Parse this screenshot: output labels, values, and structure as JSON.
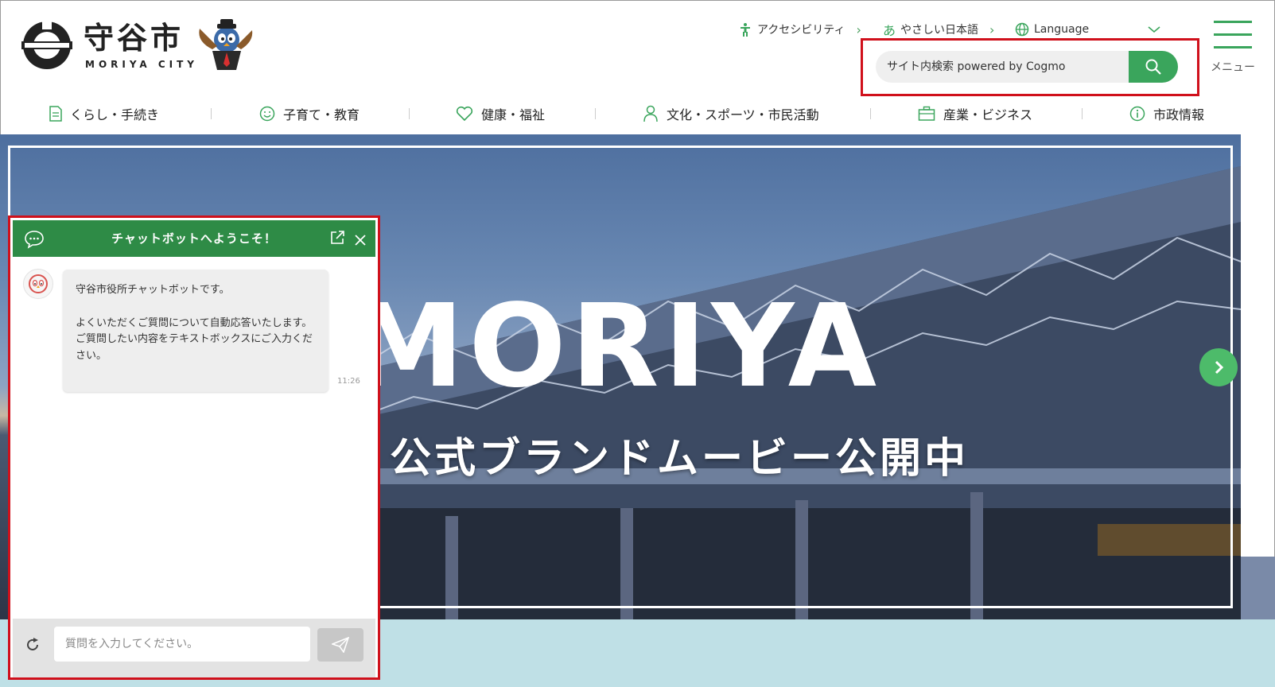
{
  "header": {
    "logo_name": "守谷市",
    "logo_sub": "MORIYA CITY",
    "accessibility": "アクセシビリティ",
    "easy_japanese": "やさしい日本語",
    "easy_japanese_icon_glyph": "あ",
    "language": "Language",
    "search_placeholder": "サイト内検索 powered by Cogmo",
    "menu_label": "メニュー"
  },
  "nav": {
    "items": [
      {
        "label": "くらし・手続き",
        "icon": "document-icon"
      },
      {
        "label": "子育て・教育",
        "icon": "smile-icon"
      },
      {
        "label": "健康・福祉",
        "icon": "heart-icon"
      },
      {
        "label": "文化・スポーツ・市民活動",
        "icon": "person-icon"
      },
      {
        "label": "産業・ビジネス",
        "icon": "briefcase-icon"
      },
      {
        "label": "市政情報",
        "icon": "info-icon"
      }
    ]
  },
  "hero": {
    "title": "MORIYA",
    "subtitle": "公式ブランドムービー公開中"
  },
  "chatbot": {
    "title": "チャットボットへようこそ！",
    "message_line1": "守谷市役所チャットボットです。",
    "message_line2": "よくいただくご質問について自動応答いたします。",
    "message_line3": "ご質問したい内容をテキストボックスにご入力ください。",
    "time": "11:26",
    "input_placeholder": "質問を入力してください。"
  },
  "colors": {
    "brand_green": "#3aa55c",
    "chat_header_green": "#2e8b46",
    "highlight_red": "#d0101b",
    "band_light_blue": "#bfe0e6"
  }
}
